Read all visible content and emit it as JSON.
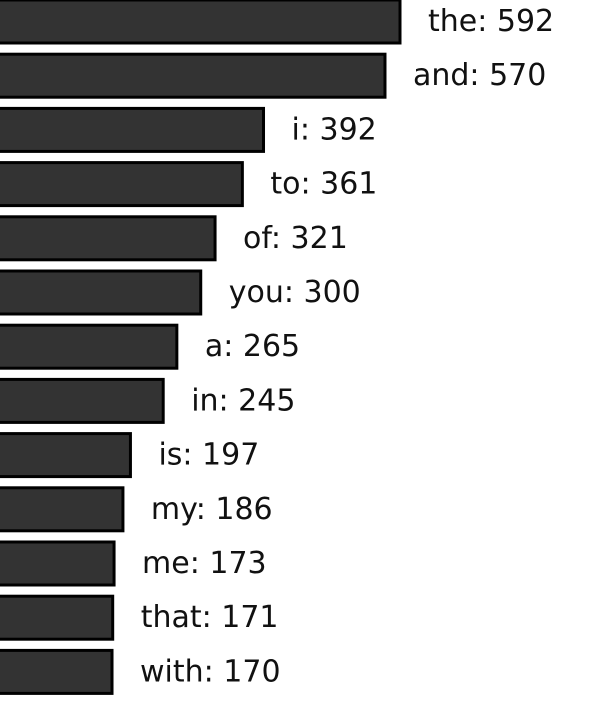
{
  "chart_data": {
    "type": "bar",
    "orientation": "horizontal",
    "categories": [
      "the",
      "and",
      "i",
      "to",
      "of",
      "you",
      "a",
      "in",
      "is",
      "my",
      "me",
      "that",
      "with"
    ],
    "values": [
      592,
      570,
      392,
      361,
      321,
      300,
      265,
      245,
      197,
      186,
      173,
      171,
      170
    ],
    "value_labels": [
      "the: 592",
      "and: 570",
      "i: 392",
      "to: 361",
      "of: 321",
      "you: 300",
      "a: 265",
      "in: 245",
      "is: 197",
      "my: 186",
      "me: 173",
      "that: 171",
      "with: 170"
    ],
    "title": "",
    "xlabel": "",
    "ylabel": "",
    "xlim": [
      0,
      592
    ],
    "grid": false,
    "legend": "none",
    "colors": {
      "bar_fill": "#333333",
      "bar_stroke": "#000000",
      "text": "#111111"
    }
  }
}
